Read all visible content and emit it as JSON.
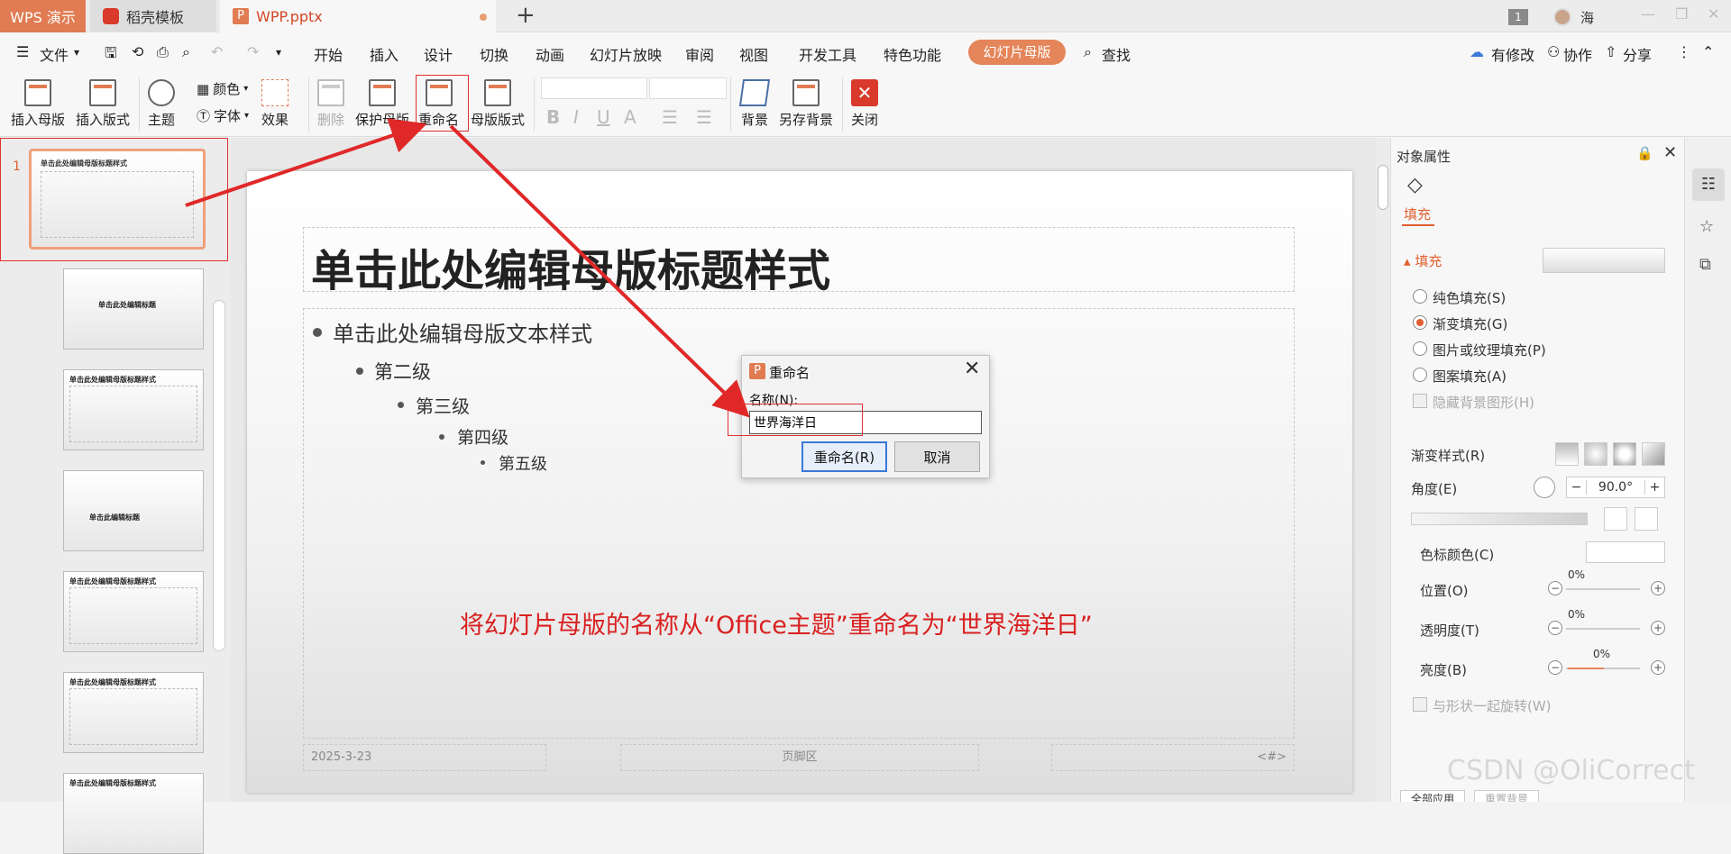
{
  "titlebar": {
    "tabs": [
      {
        "label": "WPS 演示"
      },
      {
        "label": "稻壳模板"
      },
      {
        "label": "WPP.pptx"
      }
    ],
    "window_count": "1",
    "user_name": "海"
  },
  "menubar": {
    "file_label": "文件",
    "items": [
      "开始",
      "插入",
      "设计",
      "切换",
      "动画",
      "幻灯片放映",
      "审阅",
      "视图",
      "开发工具",
      "特色功能"
    ],
    "active_item": "幻灯片母版",
    "search_label": "查找",
    "right_items": [
      "有修改",
      "协作",
      "分享"
    ]
  },
  "ribbon": {
    "insert_master": "插入母版",
    "insert_layout": "插入版式",
    "theme": "主题",
    "color": "颜色",
    "font": "字体",
    "effect": "效果",
    "delete": "删除",
    "protect_master": "保护母版",
    "rename": "重命名",
    "master_layout": "母版版式",
    "background": "背景",
    "save_background": "另存背景",
    "close": "关闭"
  },
  "slide": {
    "title": "单击此处编辑母版标题样式",
    "levels": [
      "单击此处编辑母版文本样式",
      "第二级",
      "第三级",
      "第四级",
      "第五级"
    ],
    "footer_date": "2025-3-23",
    "footer_center": "页脚区",
    "footer_number": "<#>",
    "annotation": "将幻灯片母版的名称从“Office主题”重命名为“世界海洋日”"
  },
  "thumbnails": {
    "slide_number": "1",
    "titles": [
      "单击此处编辑母版标题样式",
      "单击此处编辑标题",
      "单击此处编辑母版标题样式",
      "单击此编辑标题",
      "单击此处编辑母版标题样式",
      "单击此处编辑母版标题样式",
      "单击此处编辑母版标题样式"
    ]
  },
  "dialog": {
    "title": "重命名",
    "label": "名称(N):",
    "value": "世界海洋日",
    "ok": "重命名(R)",
    "cancel": "取消"
  },
  "properties": {
    "panel_title": "对象属性",
    "tab_fill": "填充",
    "section_fill": "填充",
    "options": [
      "纯色填充(S)",
      "渐变填充(G)",
      "图片或纹理填充(P)",
      "图案填充(A)"
    ],
    "selected_option": "渐变填充(G)",
    "hide_bg": "隐藏背景图形(H)",
    "gradient_style": "渐变样式(R)",
    "angle_label": "角度(E)",
    "angle_value": "90.0°",
    "stop_color": "色标颜色(C)",
    "position": "位置(O)",
    "position_value": "0%",
    "transparency": "透明度(T)",
    "transparency_value": "0%",
    "brightness": "亮度(B)",
    "brightness_value": "0%",
    "rotate_with_shape": "与形状一起旋转(W)",
    "apply_all": "全部应用",
    "reset_bg": "重置背景"
  },
  "watermark": "CSDN @OliCorrect",
  "colors": {
    "accent": "#e5855a",
    "annotation_red": "#d92020",
    "dialog_focus": "#3b78d8"
  }
}
